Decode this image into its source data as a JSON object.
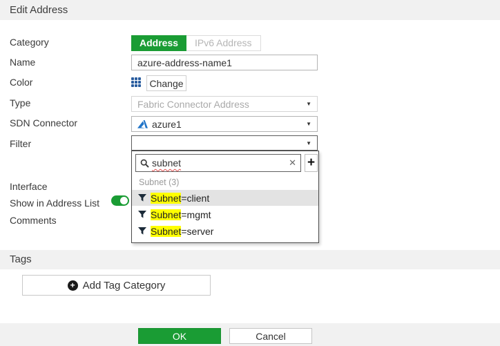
{
  "header": {
    "title": "Edit Address"
  },
  "form": {
    "category": {
      "label": "Category",
      "selected_option": "Address",
      "other_option": "IPv6 Address"
    },
    "name": {
      "label": "Name",
      "value": "azure-address-name1"
    },
    "color": {
      "label": "Color",
      "change_label": "Change",
      "swatch_color": "#2a5d9f"
    },
    "type": {
      "label": "Type",
      "value": "Fabric Connector Address",
      "disabled": true
    },
    "sdn": {
      "label": "SDN Connector",
      "value": "azure1"
    },
    "filter": {
      "label": "Filter",
      "dropdown": {
        "search_value": "subnet",
        "group_label": "Subnet (3)",
        "items": [
          {
            "highlight": "Subnet",
            "rest": "=client",
            "selected": true
          },
          {
            "highlight": "Subnet",
            "rest": "=mgmt",
            "selected": false
          },
          {
            "highlight": "Subnet",
            "rest": "=server",
            "selected": false
          }
        ]
      }
    },
    "interface": {
      "label": "Interface"
    },
    "show_in_address_list": {
      "label": "Show in Address List",
      "enabled": true
    },
    "comments": {
      "label": "Comments"
    }
  },
  "tags": {
    "title": "Tags",
    "add_button_label": "Add Tag Category"
  },
  "footer": {
    "ok_label": "OK",
    "cancel_label": "Cancel"
  },
  "icons": {
    "caret": "▼",
    "clear": "✕",
    "plus": "+",
    "circle_plus": "+"
  },
  "colors": {
    "accent_green": "#1a9c34",
    "highlight_yellow": "#ffff00",
    "bar_gray": "#f1f1f1"
  }
}
